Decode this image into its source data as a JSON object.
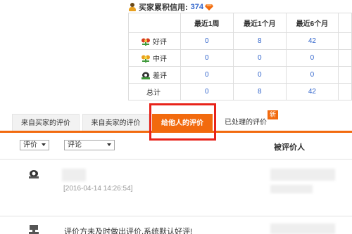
{
  "credit": {
    "label": "买家累积信用:",
    "score": "374",
    "person_icon": "buyer-person-icon",
    "badge_icon": "diamond-icon",
    "badge_color": "#f26a0e"
  },
  "rating_table": {
    "columns": [
      "最近1周",
      "最近1个月",
      "最近6个月",
      ""
    ],
    "rows": [
      {
        "label": "好评",
        "icon": "good-flower-icon",
        "values": [
          "0",
          "8",
          "42",
          ""
        ]
      },
      {
        "label": "中评",
        "icon": "neutral-flower-icon",
        "values": [
          "0",
          "0",
          "0",
          ""
        ]
      },
      {
        "label": "差评",
        "icon": "bad-rating-icon",
        "values": [
          "0",
          "0",
          "0",
          ""
        ]
      },
      {
        "label": "总计",
        "icon": "",
        "values": [
          "0",
          "8",
          "42",
          ""
        ]
      }
    ]
  },
  "tabs": [
    {
      "label": "来自买家的评价",
      "active": false
    },
    {
      "label": "来自卖家的评价",
      "active": false
    },
    {
      "label": "给他人的评价",
      "active": true
    },
    {
      "label": "已处理的评价",
      "active": false
    }
  ],
  "new_badge": "新",
  "filters": {
    "rating_select": "评价",
    "comment_select": "评论",
    "reviewee_header": "被评价人"
  },
  "reviews": [
    {
      "date": "[2016-04-14 14:26:54]",
      "text": "",
      "icon": "bad-rating-icon"
    },
    {
      "date": "",
      "text": "评价方未及时做出评价,系统默认好评!",
      "icon": "good-flower-icon"
    }
  ],
  "colors": {
    "accent": "#f26a0e",
    "link": "#3366cc",
    "highlight": "#e8231a",
    "good": "#d63b1f",
    "neutral": "#e8a020",
    "bad": "#333333"
  }
}
